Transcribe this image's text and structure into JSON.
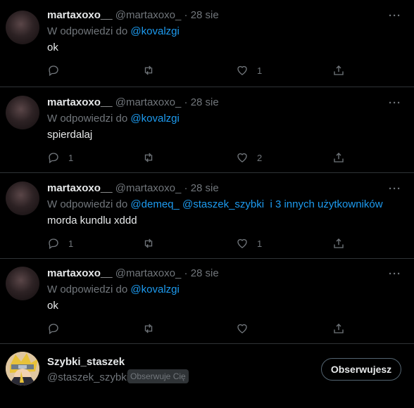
{
  "tweets": [
    {
      "name": "martaxoxo__",
      "handle": "@martaxoxo_",
      "dot": "·",
      "date": "28 sie",
      "reply_prefix": "W odpowiedzi do",
      "mentions": [
        "@kovalzgi"
      ],
      "extra": "",
      "text": "ok",
      "replies": "",
      "retweets": "",
      "likes": "1"
    },
    {
      "name": "martaxoxo__",
      "handle": "@martaxoxo_",
      "dot": "·",
      "date": "28 sie",
      "reply_prefix": "W odpowiedzi do",
      "mentions": [
        "@kovalzgi"
      ],
      "extra": "",
      "text": "spierdalaj",
      "replies": "1",
      "retweets": "",
      "likes": "2"
    },
    {
      "name": "martaxoxo__",
      "handle": "@martaxoxo_",
      "dot": "·",
      "date": "28 sie",
      "reply_prefix": "W odpowiedzi do",
      "mentions": [
        "@demeq_",
        "@staszek_szybki"
      ],
      "extra": "i 3 innych użytkowników",
      "text": "morda kundlu xddd",
      "replies": "1",
      "retweets": "",
      "likes": "1"
    },
    {
      "name": "martaxoxo__",
      "handle": "@martaxoxo_",
      "dot": "·",
      "date": "28 sie",
      "reply_prefix": "W odpowiedzi do",
      "mentions": [
        "@kovalzgi"
      ],
      "extra": "",
      "text": "ok",
      "replies": "",
      "retweets": "",
      "likes": ""
    }
  ],
  "more_label": "···",
  "profile": {
    "name": "Szybki_staszek",
    "handle": "@staszek_szybki",
    "badge": "Obserwuje Cię",
    "follow_label": "Obserwujesz"
  },
  "colors": {
    "background": "#000000",
    "accent": "#1d9bf0",
    "muted": "#71767b",
    "text": "#e7e9ea",
    "divider": "#2f3336"
  }
}
